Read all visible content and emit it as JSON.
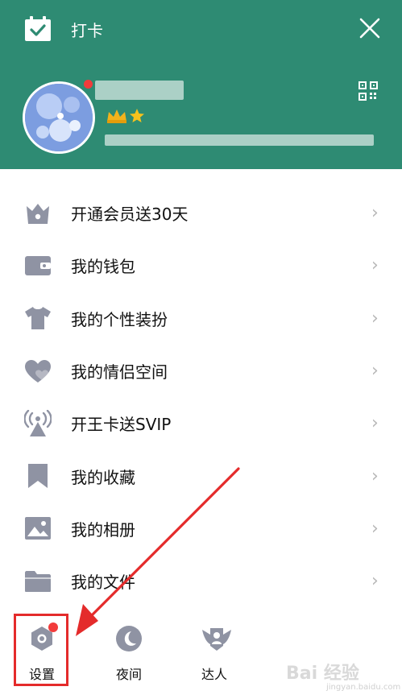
{
  "header": {
    "checkin_label": "打卡",
    "bg_color": "#2e8b73"
  },
  "menu": [
    {
      "label": "开通会员送30天",
      "icon": "crown-box-icon"
    },
    {
      "label": "我的钱包",
      "icon": "wallet-icon"
    },
    {
      "label": "我的个性装扮",
      "icon": "tshirt-icon"
    },
    {
      "label": "我的情侣空间",
      "icon": "heart-icon"
    },
    {
      "label": "开王卡送SVIP",
      "icon": "signal-tower-icon"
    },
    {
      "label": "我的收藏",
      "icon": "bookmark-icon"
    },
    {
      "label": "我的相册",
      "icon": "photo-icon"
    },
    {
      "label": "我的文件",
      "icon": "folder-icon"
    }
  ],
  "bottom": {
    "settings": "设置",
    "night": "夜间",
    "expert": "达人"
  },
  "watermark": {
    "main": "Bai 经验",
    "sub": "jingyan.baidu.com"
  },
  "colors": {
    "icon_gray": "#8f93a3",
    "alert_red": "#e42b2b"
  }
}
